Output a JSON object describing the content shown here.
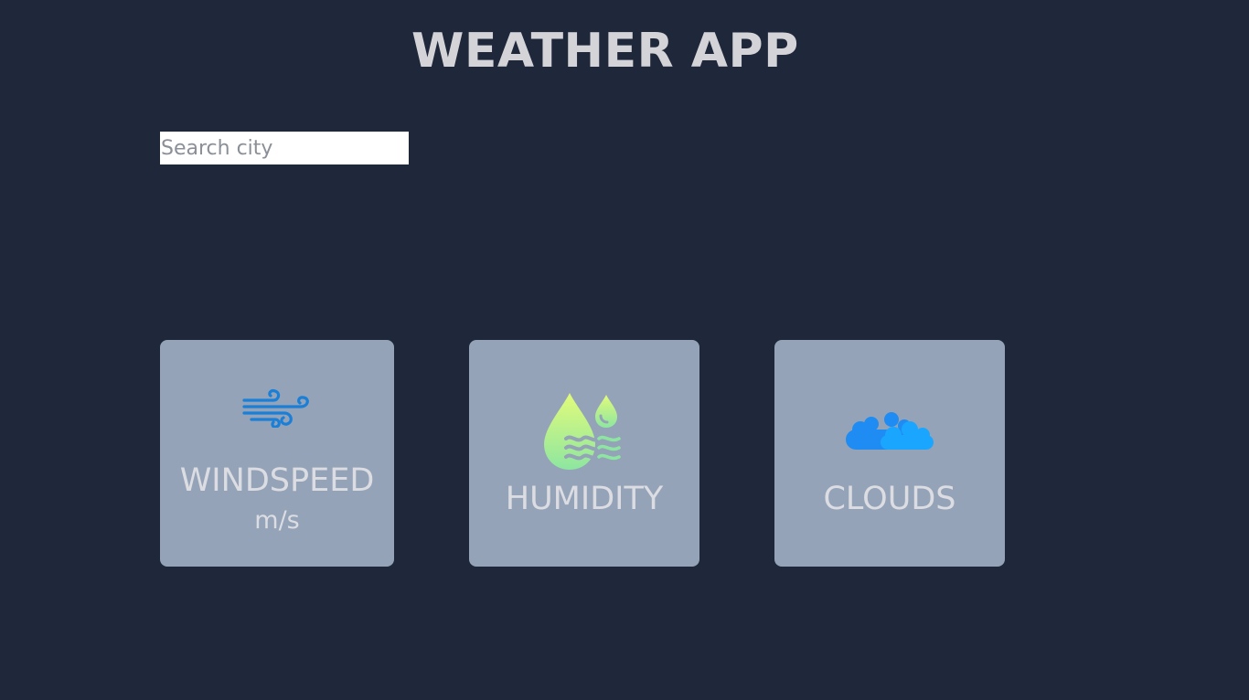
{
  "header": {
    "title": "WEATHER APP"
  },
  "search": {
    "placeholder": "Search city",
    "value": ""
  },
  "cards": {
    "windspeed": {
      "label": "WINDSPEED",
      "unit": "m/s",
      "icon": "wind-icon",
      "icon_color": "#1a7fd6"
    },
    "humidity": {
      "label": "HUMIDITY",
      "icon": "humidity-drops-icon",
      "icon_colors": [
        "#d9fa7a",
        "#7fe6a0"
      ]
    },
    "clouds": {
      "label": "CLOUDS",
      "icon": "clouds-icon",
      "icon_colors": [
        "#1e90ff",
        "#1aa3ff"
      ]
    }
  },
  "colors": {
    "background": "#1f283b",
    "card": "#94a3b8",
    "title": "#d4d4d8",
    "card_text": "#dcdde2"
  }
}
